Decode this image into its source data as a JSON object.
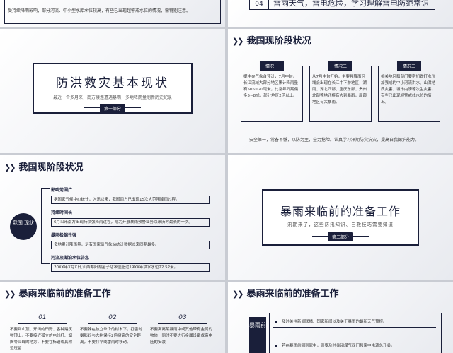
{
  "slide1": {
    "text": "受持续降雨影响，部分河流、中小型水库水位较高，有些已出现超警戒水位的情况，需特别注意。"
  },
  "slide2": {
    "num": "04",
    "title": "雷雨天气，雷电危险，学习理解雷电防范常识"
  },
  "slide3": {
    "title": "防洪救灾基本现状",
    "subtitle": "最近一个多月来，南方接连遭遇暴雨，多地降雨量刷新历史纪录",
    "part": "第一部分"
  },
  "slide4": {
    "header": "我国现阶段状况",
    "cards": [
      {
        "badge": "情况一",
        "body": "据中央气象台预计，7月中旬，长江流域大部分地区累计降雨量有50~120毫米，比常年同期偏多5~8成，部分地区2倍以上。"
      },
      {
        "badge": "情况二",
        "body": "从7月中旬开始，主要强降雨区域会出现在长江中下游地区，湖南、湖北西部、重庆东部、贵州北部等地还将有大到暴雨，局部地区有大暴雨。"
      },
      {
        "badge": "情况三",
        "body": "相关地区和部门要密切做好水位加强成的中小河流洪水、山洪地质灾害、城市内涝等次生灾害，有些已出现超警戒线水位的情况。"
      }
    ],
    "footer": "安全第一，常备不懈，以防为主，全力抢险。认真学习汛期防灾抗灾，提高自我保护能力。"
  },
  "slide5": {
    "header": "我国现阶段状况",
    "circle": "我国 现状",
    "items": [
      {
        "title": "影响范围广",
        "body": "据国家气候中心统计，入汛以来，我国南方已出现15次大范围降雨过程。"
      },
      {
        "title": "持续时间长",
        "body": "6月以来南方出现持续强降雨过程，成为开展暴雨预警业务以来历时最长的一次。"
      },
      {
        "title": "暴雨极端性强",
        "body": "多地累计降雨量，是有国家级气象站统计数据以来同期最多。"
      },
      {
        "title": "河流及湖泊水位告急",
        "body": "20XX年X月X日,江西鄱阳湖星子站水位超过19XX年洪水水位22.52米。"
      }
    ]
  },
  "slide6": {
    "title": "暴雨来临前的准备工作",
    "subtitle": "汛期来了，这些防汛知识、自救技巧需要知道",
    "part": "第二部分"
  },
  "slide7": {
    "header": "暴雨来临前的准备工作",
    "cols": [
      {
        "n": "01",
        "text": "不要到山顶、开阔的田野、各种建筑物顶上，不要接近孤立的电线杆、烟囱等高耸的地方，不要在标语或其附近逗留"
      },
      {
        "n": "02",
        "text": "不要躲在独立单个的树木下，打雷时摄影好与大树保持2倍树高的安全距离，不要打伞或雷雨时移动。"
      },
      {
        "n": "03",
        "text": "不要离离某暴雨中或其他带有金属的物体，同时不要进行金属设备或高电压的安装"
      }
    ]
  },
  "slide8": {
    "header": "暴雨来临前的准备工作",
    "vtext": "暴雨前",
    "rows": [
      "及时关注新闻联播、国家新闻以及关于暴雨的最新天气预报。",
      "若在暴雨前回到家中，则要及时关闭煤气阀门和家中电源总开关。"
    ]
  }
}
